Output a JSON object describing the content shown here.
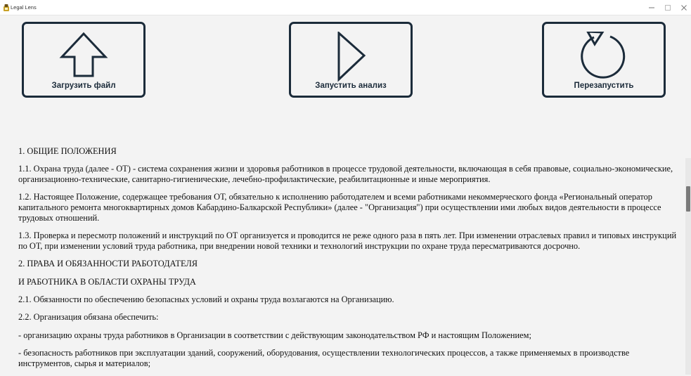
{
  "window": {
    "title": "Legal Lens",
    "controls": {
      "minimize": "minimize-icon",
      "maximize": "maximize-icon",
      "close": "close-icon"
    }
  },
  "toolbar": {
    "upload_label": "Загрузить файл",
    "analyze_label": "Запустить анализ",
    "restart_label": "Перезапустить",
    "icons": {
      "upload": "arrow-up-icon",
      "analyze": "play-icon",
      "restart": "refresh-icon"
    },
    "accent_color": "#1b2b3a"
  },
  "document": {
    "paragraphs": [
      "1. ОБЩИЕ ПОЛОЖЕНИЯ",
      "1.1. Охрана труда (далее - ОТ) - система сохранения жизни и здоровья работников в процессе трудовой деятельности, включающая в себя правовые, социально-экономические, организационно-технические, санитарно-гигиенические, лечебно-профилактические, реабилитационные и иные мероприятия.",
      "1.2. Настоящее Положение, содержащее требования ОТ, обязательно к исполнению работодателем и всеми работниками некоммерческого фонда «Региональный оператор капитального ремонта многоквартирных домов Кабардино-Балкарской Республики» (далее - \"Организация\") при осуществлении ими любых видов деятельности в процессе трудовых отношений.",
      "1.3. Проверка и пересмотр положений и инструкций по ОТ организуется и проводится не реже одного раза в пять лет. При изменении отраслевых правил и типовых инструкций по ОТ, при изменении условий труда работника, при внедрении новой техники и технологий инструкции по охране труда пересматриваются досрочно.",
      "2. ПРАВА И ОБЯЗАННОСТИ РАБОТОДАТЕЛЯ",
      "И РАБОТНИКА В ОБЛАСТИ ОХРАНЫ ТРУДА",
      "2.1. Обязанности по обеспечению безопасных условий и охраны труда возлагаются на Организацию.",
      "2.2. Организация обязана обеспечить:",
      "- организацию охраны труда работников в Организации в соответствии с действующим законодательством РФ и настоящим Положением;",
      "- безопасность работников при эксплуатации зданий, сооружений, оборудования, осуществлении технологических процессов, а также применяемых в производстве инструментов, сырья и материалов;"
    ]
  }
}
